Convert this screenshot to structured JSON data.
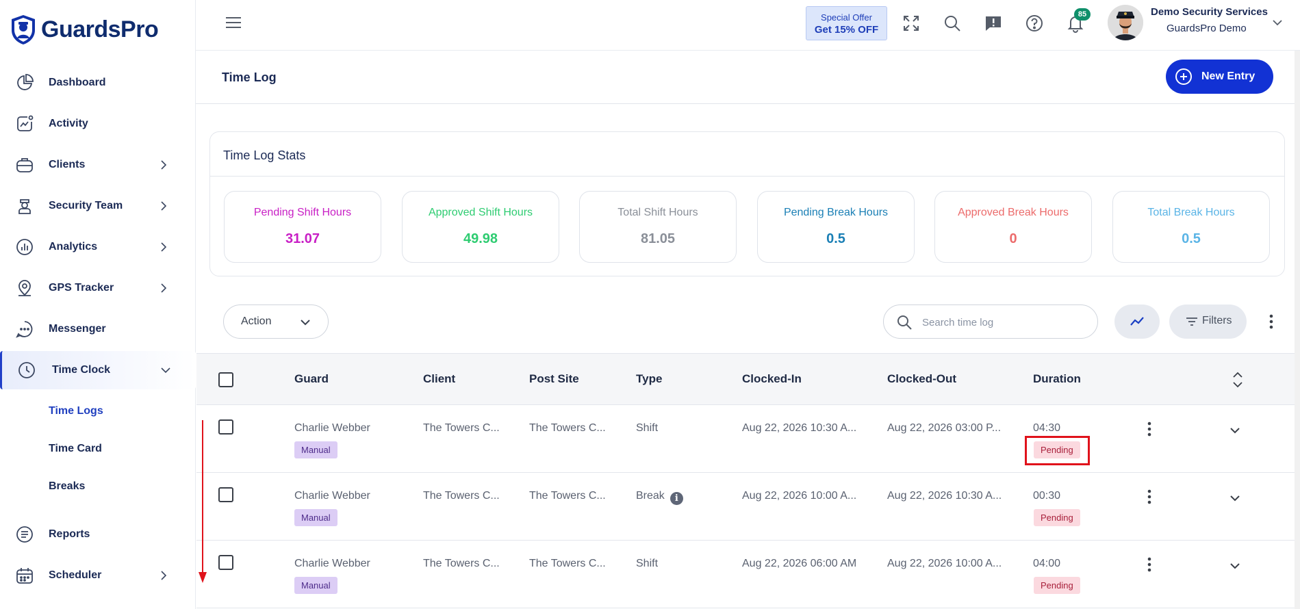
{
  "brand": {
    "name": "GuardsPro",
    "logo_icon": "guard-shield-logo"
  },
  "sidebar": {
    "items": [
      {
        "label": "Dashboard",
        "icon": "pie-chart-icon"
      },
      {
        "label": "Activity",
        "icon": "activity-chart-icon"
      },
      {
        "label": "Clients",
        "icon": "briefcase-icon"
      },
      {
        "label": "Security Team",
        "icon": "guard-icon"
      },
      {
        "label": "Analytics",
        "icon": "bar-chart-icon"
      },
      {
        "label": "GPS Tracker",
        "icon": "location-pin-icon"
      },
      {
        "label": "Messenger",
        "icon": "chat-bubble-icon"
      },
      {
        "label": "Time Clock",
        "icon": "clock-icon"
      },
      {
        "label": "Reports",
        "icon": "report-list-icon"
      },
      {
        "label": "Scheduler",
        "icon": "calendar-icon"
      }
    ],
    "time_clock_sub": [
      "Time Logs",
      "Time Card",
      "Breaks"
    ]
  },
  "header": {
    "offer_line1": "Special Offer",
    "offer_line2": "Get 15% OFF",
    "notifications_count": "85",
    "user_name": "Demo Security Services",
    "user_org": "GuardsPro Demo"
  },
  "page": {
    "title": "Time Log",
    "new_entry_label": "New Entry"
  },
  "stats": {
    "title": "Time Log Stats",
    "cards": [
      {
        "label": "Pending Shift Hours",
        "value": "31.07",
        "color": "#c81fc5"
      },
      {
        "label": "Approved Shift Hours",
        "value": "49.98",
        "color": "#2ecc71"
      },
      {
        "label": "Total Shift Hours",
        "value": "81.05",
        "color": "#8a8f98"
      },
      {
        "label": "Pending Break Hours",
        "value": "0.5",
        "color": "#1a7fb5"
      },
      {
        "label": "Approved Break Hours",
        "value": "0",
        "color": "#ec6b6b"
      },
      {
        "label": "Total Break Hours",
        "value": "0.5",
        "color": "#5ab4e6"
      }
    ]
  },
  "toolbar": {
    "action_label": "Action",
    "search_placeholder": "Search time log",
    "filters_label": "Filters"
  },
  "table": {
    "headers": [
      "Guard",
      "Client",
      "Post Site",
      "Type",
      "Clocked-In",
      "Clocked-Out",
      "Duration"
    ],
    "rows": [
      {
        "guard": "Charlie Webber",
        "tag": "Manual",
        "client": "The Towers C...",
        "post_site": "The Towers C...",
        "type": "Shift",
        "clocked_in": "Aug 22, 2026 10:30 A...",
        "clocked_out": "Aug 22, 2026 03:00 P...",
        "duration": "04:30",
        "status": "Pending"
      },
      {
        "guard": "Charlie Webber",
        "tag": "Manual",
        "client": "The Towers C...",
        "post_site": "The Towers C...",
        "type": "Break",
        "clocked_in": "Aug 22, 2026 10:00 A...",
        "clocked_out": "Aug 22, 2026 10:30 A...",
        "duration": "00:30",
        "status": "Pending"
      },
      {
        "guard": "Charlie Webber",
        "tag": "Manual",
        "client": "The Towers C...",
        "post_site": "The Towers C...",
        "type": "Shift",
        "clocked_in": "Aug 22, 2026 06:00 AM",
        "clocked_out": "Aug 22, 2026 10:00 A...",
        "duration": "04:00",
        "status": "Pending"
      }
    ]
  },
  "annotations": {
    "highlight_color": "#e0121b"
  }
}
